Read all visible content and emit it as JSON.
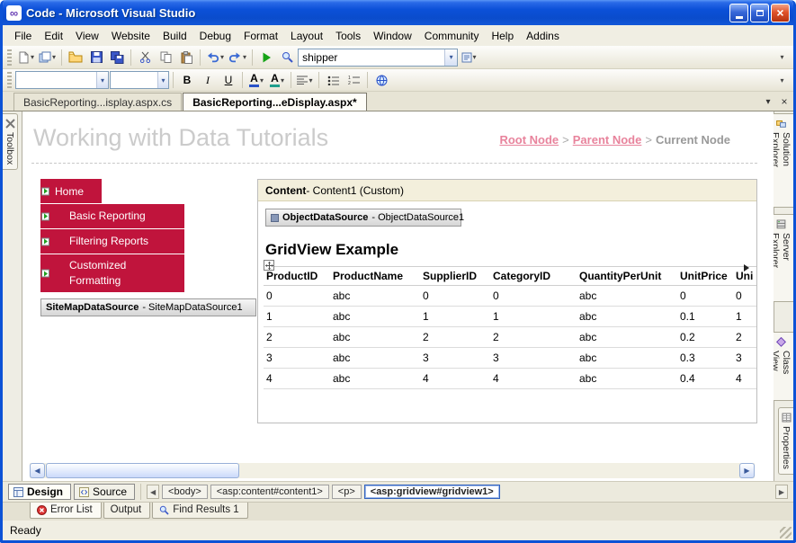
{
  "window": {
    "title": "Code - Microsoft Visual Studio"
  },
  "menubar": {
    "items": [
      "File",
      "Edit",
      "View",
      "Website",
      "Build",
      "Debug",
      "Format",
      "Layout",
      "Tools",
      "Window",
      "Community",
      "Help",
      "Addins"
    ]
  },
  "toolbars": {
    "combo_value": "shipper"
  },
  "doc_tabs": {
    "inactive": "BasicReporting...isplay.aspx.cs",
    "active": "BasicReporting...eDisplay.aspx*"
  },
  "left_strip": {
    "toolbox": "Toolbox"
  },
  "side_tabs": [
    "Solution Explorer",
    "Server Explorer",
    "Class View",
    "Properties"
  ],
  "page": {
    "title": "Working with Data Tutorials",
    "breadcrumb": {
      "root": "Root Node",
      "sep": ">",
      "parent": "Parent Node",
      "current": "Current Node"
    },
    "nav": {
      "home": "Home",
      "item1": "Basic Reporting",
      "item2": "Filtering Reports",
      "item3": "Customized Formatting"
    },
    "sitemap_bold": "SiteMapDataSource",
    "sitemap_rest": " - SiteMapDataSource1",
    "content_bold": "Content",
    "content_rest": " - Content1 (Custom)",
    "ods_bold": "ObjectDataSource",
    "ods_rest": " - ObjectDataSource1",
    "gridview_heading": "GridView Example"
  },
  "grid": {
    "headers": [
      "ProductID",
      "ProductName",
      "SupplierID",
      "CategoryID",
      "QuantityPerUnit",
      "UnitPrice",
      "Uni"
    ],
    "rows": [
      [
        "0",
        "abc",
        "0",
        "0",
        "abc",
        "0",
        "0"
      ],
      [
        "1",
        "abc",
        "1",
        "1",
        "abc",
        "0.1",
        "1"
      ],
      [
        "2",
        "abc",
        "2",
        "2",
        "abc",
        "0.2",
        "2"
      ],
      [
        "3",
        "abc",
        "3",
        "3",
        "abc",
        "0.3",
        "3"
      ],
      [
        "4",
        "abc",
        "4",
        "4",
        "abc",
        "0.4",
        "4"
      ]
    ]
  },
  "viewbar": {
    "design": "Design",
    "source": "Source",
    "tags": [
      "<body>",
      "<asp:content#content1>",
      "<p>",
      "<asp:gridview#gridview1>"
    ]
  },
  "panel_tabs": {
    "error_list": "Error List",
    "output": "Output",
    "find_results": "Find Results 1"
  },
  "statusbar": {
    "ready": "Ready"
  },
  "colors": {
    "nav_red": "#c0143c",
    "breadcrumb_link": "#e8839c",
    "page_title_gray": "#cbcbcb",
    "titlebar_blue": "#0c52d6"
  }
}
